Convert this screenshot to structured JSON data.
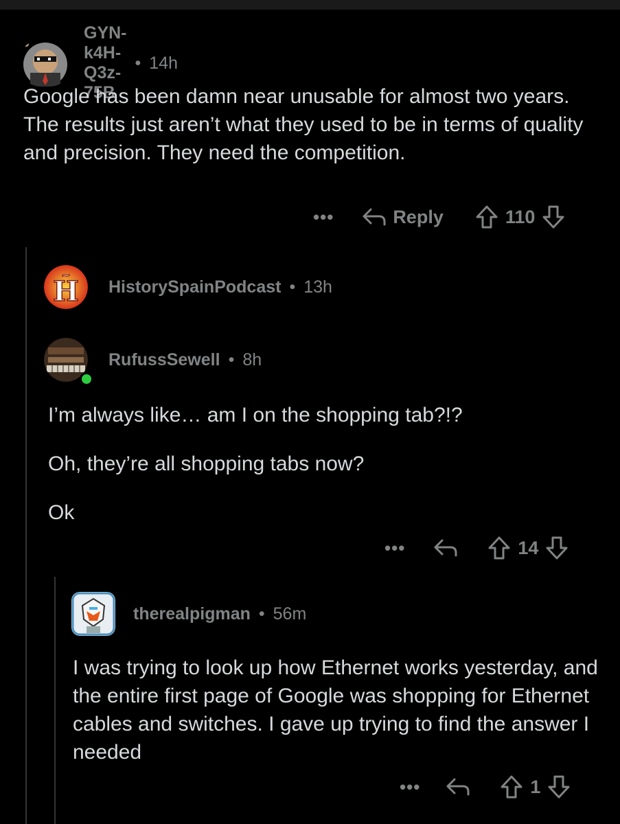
{
  "comments": [
    {
      "username": "GYN-k4H-Q3z-75B",
      "sep": "•",
      "time": "14h",
      "body": [
        "Google has been damn near unusable for almost two years. The results just aren’t what they used to be in terms of quality and precision. They need the competition."
      ],
      "more": "•••",
      "reply_label": "Reply",
      "votes": "110"
    },
    {
      "username": "HistorySpainPodcast",
      "sep": "•",
      "time": "13h",
      "avatar_letter": "Ñ",
      "avatar_letter2": "H"
    },
    {
      "username": "RufussSewell",
      "sep": "•",
      "time": "8h",
      "body": [
        "I’m always like… am I on the shopping tab?!?",
        "Oh, they’re all shopping tabs now?",
        "Ok"
      ],
      "more": "•••",
      "votes": "14"
    },
    {
      "username": "therealpigman",
      "sep": "•",
      "time": "56m",
      "body": [
        "I was trying to look up how Ethernet works yesterday, and the entire first page of Google was shopping for Ethernet cables and switches. I gave up trying to find the answer I needed"
      ],
      "more": "•••",
      "votes": "1"
    }
  ],
  "colors": {
    "background": "#000000",
    "text": "#d7dadc",
    "meta": "#818384",
    "thread_line": "#343536",
    "online": "#2ecc40"
  }
}
